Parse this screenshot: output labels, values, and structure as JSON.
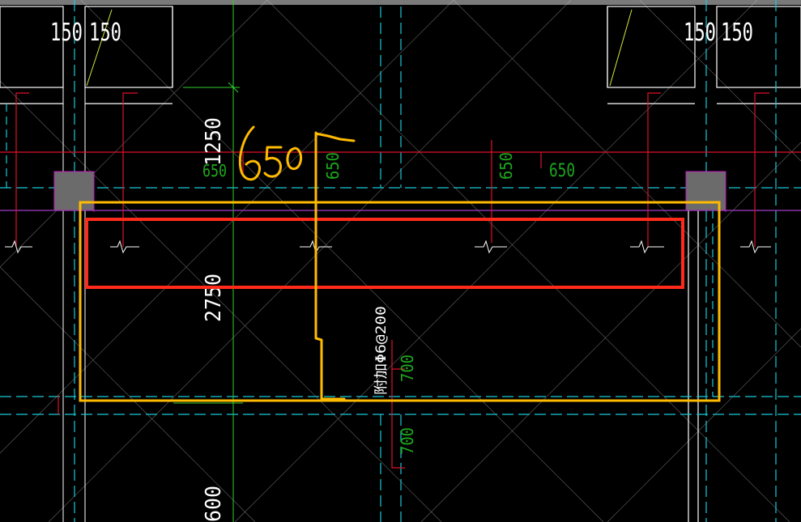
{
  "colors": {
    "background": "#000000",
    "white": "#ffffff",
    "cyan": "#19c9d6",
    "green": "#1ea81e",
    "red": "#e0102a",
    "yellow_line": "#d6e63a",
    "magenta": "#c51ac5",
    "column_fill": "#6b6b6b",
    "highlight_yellow": "#ffbb00",
    "highlight_red": "#ff2a1a"
  },
  "labels": {
    "left_top_a": "150",
    "left_top_b": "150",
    "right_top_a": "150",
    "right_top_b": "150",
    "dim_1250": "1250",
    "dim_650_left": "650",
    "dim_650_center": "650",
    "dim_650_mid": "650",
    "dim_650_right": "650",
    "dim_2750": "2750",
    "rebar_note": "附加Φ6@200",
    "dim_700_upper": "700",
    "dim_700_lower": "700",
    "dim_600_bottom": "600"
  },
  "annotation": {
    "handwritten_text": "650"
  }
}
